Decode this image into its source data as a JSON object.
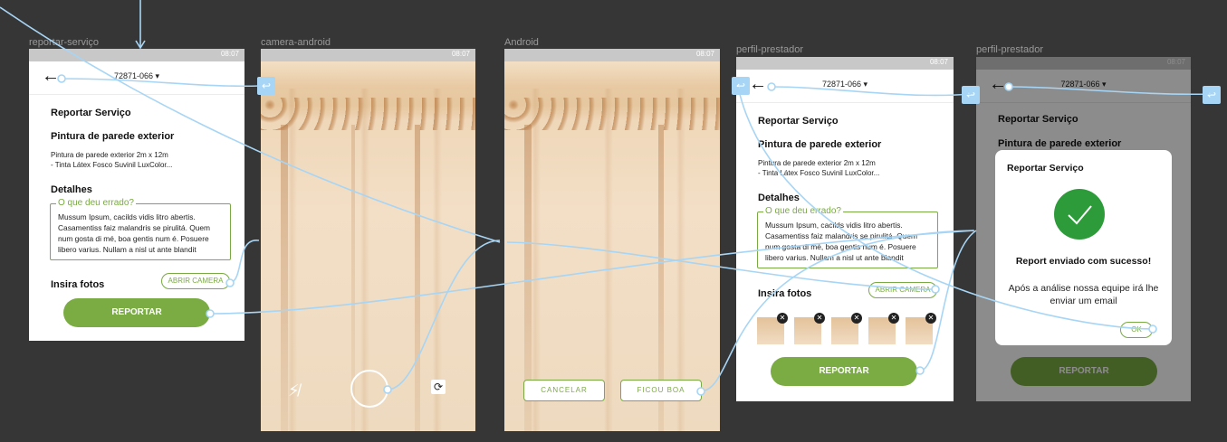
{
  "frames": {
    "f1": "reportar-serviço",
    "f2": "camera-android",
    "f3": "Android",
    "f4": "perfil-prestador",
    "f5": "perfil-prestador"
  },
  "status_time": "08:07",
  "cep": "72871-066",
  "report": {
    "title": "Reportar Serviço",
    "service_title": "Pintura de parede exterior",
    "service_line1": "Pintura de parede exterior 2m x 12m",
    "service_line2": "- Tinta Látex Fosco Suvinil LuxColor...",
    "details_label": "Detalhes",
    "field_legend": "O que deu errado?",
    "field_text": "Mussum Ipsum, cacilds vidis litro abertis. Casamentiss faiz malandris se pirulitá. Quem num gosta di mé, boa gentis num é. Posuere libero varius. Nullam a nisl ut ante blandit",
    "photos_label": "Insira fotos",
    "open_camera": "ABRIR CAMERA",
    "submit": "REPORTAR"
  },
  "camera": {
    "cancel": "CANCELAR",
    "ok": "FICOU BOA",
    "flash_icon": "flash-off-icon",
    "switch_icon": "switch-camera-icon"
  },
  "modal": {
    "title": "Reportar Serviço",
    "headline": "Report enviado com sucesso!",
    "message": "Após a análise nossa equipe irá lhe enviar um email",
    "ok": "OK"
  },
  "colors": {
    "accent_green": "#7aac43",
    "success_green": "#2e9b3b",
    "proto_blue": "#a7d5f5"
  }
}
